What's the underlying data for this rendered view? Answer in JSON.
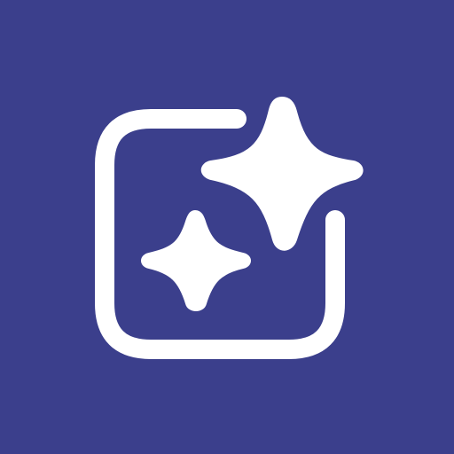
{
  "icon": {
    "name": "sparkles-app-icon",
    "background_color": "#3B3F8C",
    "foreground_color": "#FFFFFF",
    "elements": [
      "rounded-square-frame-icon",
      "large-sparkle-icon",
      "small-sparkle-icon"
    ]
  }
}
